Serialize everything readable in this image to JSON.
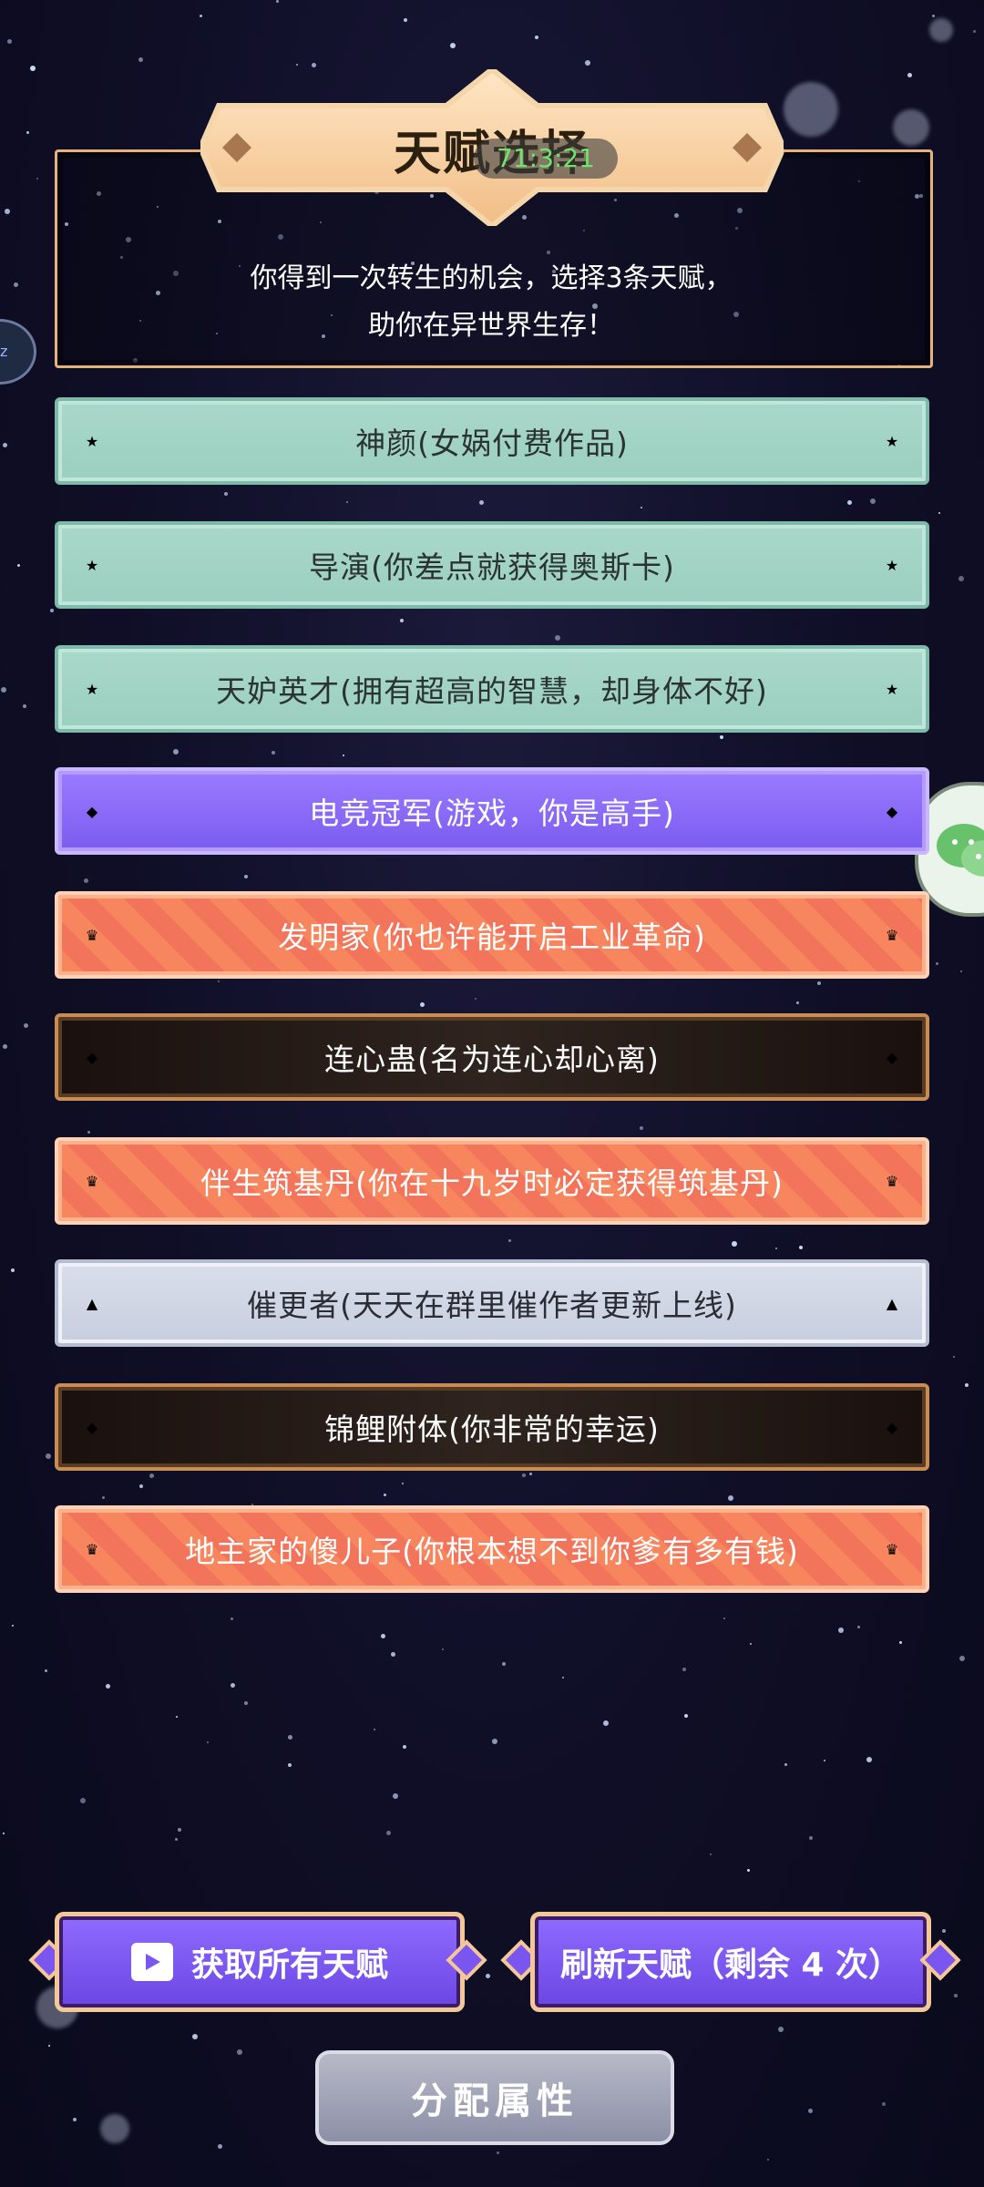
{
  "header": {
    "title": "天赋选择",
    "badge": "71:3:21",
    "subtitle_line1": "你得到一次转生的机会，选择3条天赋，",
    "subtitle_line2": "助你在异世界生存！"
  },
  "talents": [
    {
      "label": "神颜(女娲付费作品)",
      "tier": "teal",
      "icon": "star-icon"
    },
    {
      "label": "导演(你差点就获得奥斯卡)",
      "tier": "teal",
      "icon": "star-icon"
    },
    {
      "label": "天妒英才(拥有超高的智慧，却身体不好)",
      "tier": "teal",
      "icon": "star-icon"
    },
    {
      "label": "电竞冠军(游戏，你是高手)",
      "tier": "purple",
      "icon": "gem-icon"
    },
    {
      "label": "发明家(你也许能开启工业革命)",
      "tier": "orange",
      "icon": "crown-icon"
    },
    {
      "label": "连心蛊(名为连心却心离)",
      "tier": "dark",
      "icon": "diamond-icon"
    },
    {
      "label": "伴生筑基丹(你在十九岁时必定获得筑基丹)",
      "tier": "orange",
      "icon": "crown-icon"
    },
    {
      "label": "催更者(天天在群里催作者更新上线)",
      "tier": "silver",
      "icon": "triangle-icon"
    },
    {
      "label": "锦鲤附体(你非常的幸运)",
      "tier": "dark",
      "icon": "diamond-icon"
    },
    {
      "label": "地主家的傻儿子(你根本想不到你爹有多有钱)",
      "tier": "orange",
      "icon": "crown-icon"
    }
  ],
  "buttons": {
    "get_all": "获取所有天赋",
    "refresh": "刷新天赋（剩余 4 次）",
    "assign": "分配属性"
  },
  "side": {
    "left_tab": "zz"
  },
  "colors": {
    "gold": "#f3c796",
    "teal": "#a9d8c9",
    "purple": "#8f6bff",
    "orange": "#f7865f"
  }
}
